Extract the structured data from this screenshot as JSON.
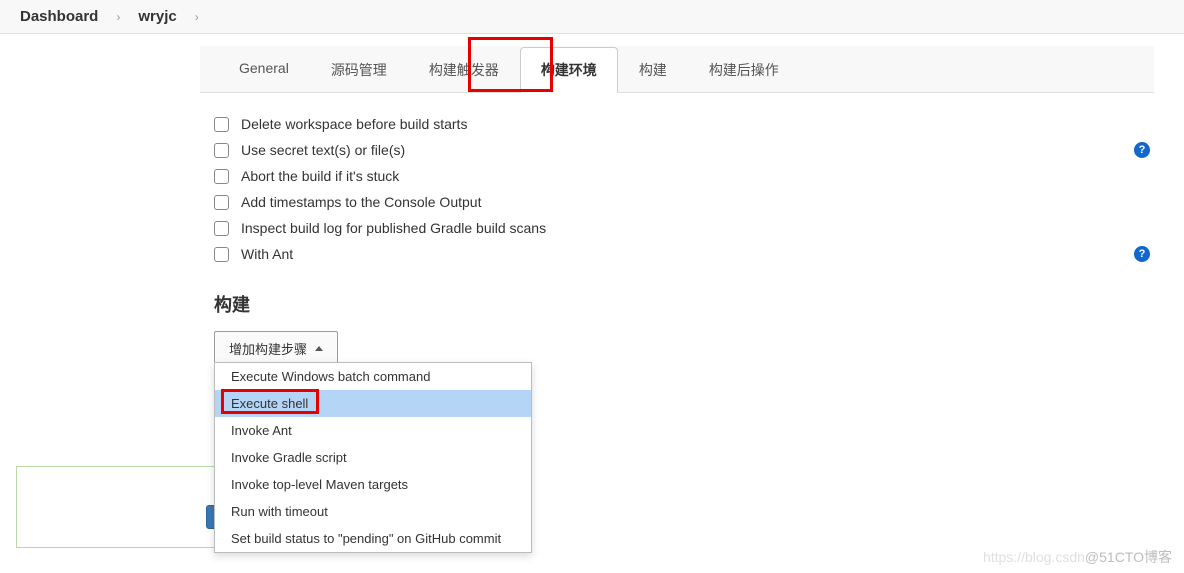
{
  "breadcrumb": {
    "items": [
      "Dashboard",
      "wryjc"
    ]
  },
  "tabs": {
    "items": [
      {
        "label": "General"
      },
      {
        "label": "源码管理"
      },
      {
        "label": "构建触发器"
      },
      {
        "label": "构建环境",
        "active": true
      },
      {
        "label": "构建"
      },
      {
        "label": "构建后操作"
      }
    ]
  },
  "build_environment": {
    "options": [
      {
        "label": "Delete workspace before build starts",
        "help": false
      },
      {
        "label": "Use secret text(s) or file(s)",
        "help": true
      },
      {
        "label": "Abort the build if it's stuck",
        "help": false
      },
      {
        "label": "Add timestamps to the Console Output",
        "help": false
      },
      {
        "label": "Inspect build log for published Gradle build scans",
        "help": false
      },
      {
        "label": "With Ant",
        "help": true
      }
    ]
  },
  "build_section": {
    "title": "构建",
    "add_step_label": "增加构建步骤",
    "dropdown_items": [
      {
        "label": "Execute Windows batch command"
      },
      {
        "label": "Execute shell",
        "selected": true
      },
      {
        "label": "Invoke Ant"
      },
      {
        "label": "Invoke Gradle script"
      },
      {
        "label": "Invoke top-level Maven targets"
      },
      {
        "label": "Run with timeout"
      },
      {
        "label": "Set build status to \"pending\" on GitHub commit"
      }
    ]
  },
  "watermark": {
    "faint": "https://blog.csdn",
    "dark": "@51CTO博客"
  }
}
